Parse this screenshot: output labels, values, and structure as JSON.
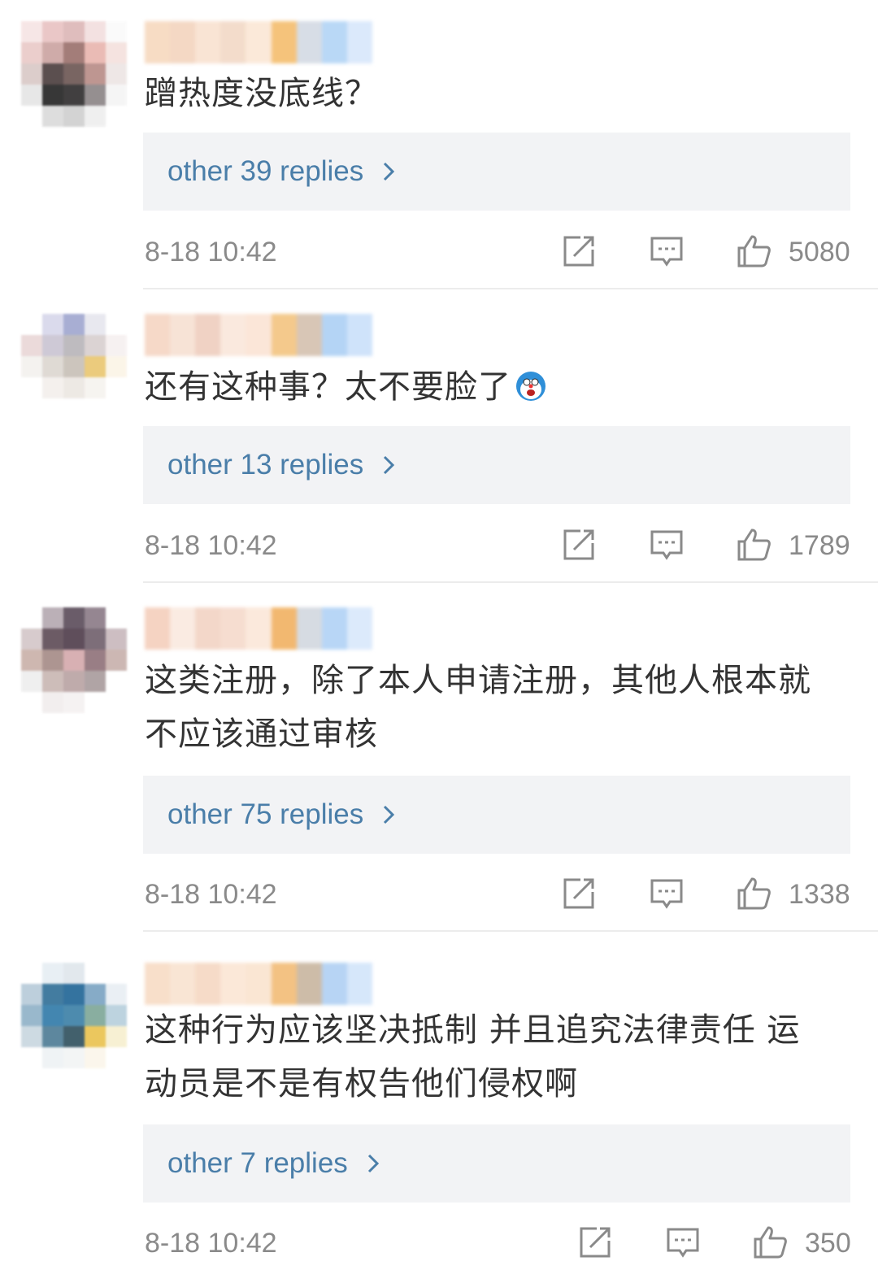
{
  "comments": [
    {
      "text_lines": [
        "蹭热度没底线？"
      ],
      "replies_label": "other 39 replies",
      "time": "8-18 10:42",
      "likes": "5080",
      "avatar_colors": [
        "#f6e4e4",
        "#e8c2c2",
        "#dcb6b6",
        "#f2dede",
        "#fafafa",
        "#e9c9c7",
        "#caa3a0",
        "#9a6f6b",
        "#e8b4ad",
        "#f4e1dd",
        "#d9c8c6",
        "#4a3c3c",
        "#6b5552",
        "#b78b86",
        "#ede5e4",
        "#e5e5e5",
        "#222222",
        "#2d2b2c",
        "#8a8385",
        "#f5f5f5",
        "#ffffff",
        "#dadada",
        "#cfcfcf",
        "#eeeeee",
        "#ffffff"
      ],
      "name_colors": [
        "#f7dcc4",
        "#f4d8c4",
        "#f9e4d4",
        "#f3dccb",
        "#fbe9d9",
        "#f5c37b",
        "#d7dde6",
        "#b9d8f6",
        "#dbe9fb"
      ]
    },
    {
      "text_lines": [
        "还有这种事？太不要脸了"
      ],
      "replies_label": "other 13 replies",
      "time": "8-18 10:42",
      "likes": "1789",
      "avatar_colors": [
        "#ffffff",
        "#d7d7ea",
        "#9fa6cf",
        "#e6e6ee",
        "#ffffff",
        "#e9d6d6",
        "#c9c4d2",
        "#b7b4b9",
        "#d8cfcf",
        "#f6f0f0",
        "#f3f1ee",
        "#dcd6d0",
        "#c7bfb6",
        "#e9c66f",
        "#fbf4e6",
        "#ffffff",
        "#f3efec",
        "#ece7e2",
        "#f6f3ef",
        "#ffffff",
        "#ffffff",
        "#ffffff",
        "#ffffff",
        "#ffffff",
        "#ffffff"
      ],
      "name_colors": [
        "#f6d9c8",
        "#f7e3d6",
        "#f0d2c4",
        "#fae9de",
        "#fbe6d8",
        "#f4c98c",
        "#d8c6b6",
        "#b4d4f5",
        "#cfe3fa"
      ]
    },
    {
      "text_lines": [
        "这类注册，除了本人申请注册，其他人根本就",
        "不应该通过审核"
      ],
      "replies_label": "other 75 replies",
      "time": "8-18 10:42",
      "likes": "1338",
      "avatar_colors": [
        "#ffffff",
        "#b4a8b0",
        "#5a4b59",
        "#8a7a86",
        "#ffffff",
        "#d3c6c8",
        "#5d4a55",
        "#4e3b4a",
        "#6f5f6b",
        "#c8b8bc",
        "#c9b0a8",
        "#a58a86",
        "#d4a8ab",
        "#8f7178",
        "#c7b0ab",
        "#eeeeee",
        "#c8b6b2",
        "#b9a2a3",
        "#a89b9c",
        "#ffffff",
        "#ffffff",
        "#f1eded",
        "#f5f1f1",
        "#ffffff",
        "#ffffff"
      ],
      "name_colors": [
        "#f5d3c2",
        "#faebe2",
        "#f3d7c9",
        "#f6ddd0",
        "#fbe9dc",
        "#f2b870",
        "#d6dbe2",
        "#b8d6f6",
        "#dceafb"
      ]
    },
    {
      "text_lines": [
        "这种行为应该坚决抵制 并且追究法律责任 运",
        "动员是不是有权告他们侵权啊"
      ],
      "replies_label": "other 7 replies",
      "time": "8-18 10:42",
      "likes": "350",
      "avatar_colors": [
        "#ffffff",
        "#e6eef3",
        "#dfe6ec",
        "#ffffff",
        "#ffffff",
        "#b6cad9",
        "#2f6e96",
        "#1f6495",
        "#7aa3c2",
        "#e8eef3",
        "#8fb1c7",
        "#2f7aa8",
        "#3a7fa6",
        "#7da696",
        "#b6cfdc",
        "#c8d6df",
        "#4c7b94",
        "#2e4f5d",
        "#e9c24d",
        "#f7efcf",
        "#ffffff",
        "#eef2f4",
        "#f2f4f5",
        "#fbf6ea",
        "#ffffff"
      ],
      "name_colors": [
        "#f8dfca",
        "#f9e5d4",
        "#f6dbc8",
        "#fbe8d8",
        "#fae6d3",
        "#f3c283",
        "#cdbca8",
        "#b7d4f4",
        "#d6e7fa"
      ]
    }
  ],
  "icons": {
    "share": "share-external-icon",
    "reply": "comment-bubble-icon",
    "like": "thumbs-up-icon",
    "chevron": "chevron-right-icon",
    "emoji": "surprised-face-emoji"
  },
  "colors": {
    "link": "#4a7ea9",
    "reply_bg": "#f2f3f5",
    "meta": "#8a8a8a",
    "text": "#333333"
  }
}
